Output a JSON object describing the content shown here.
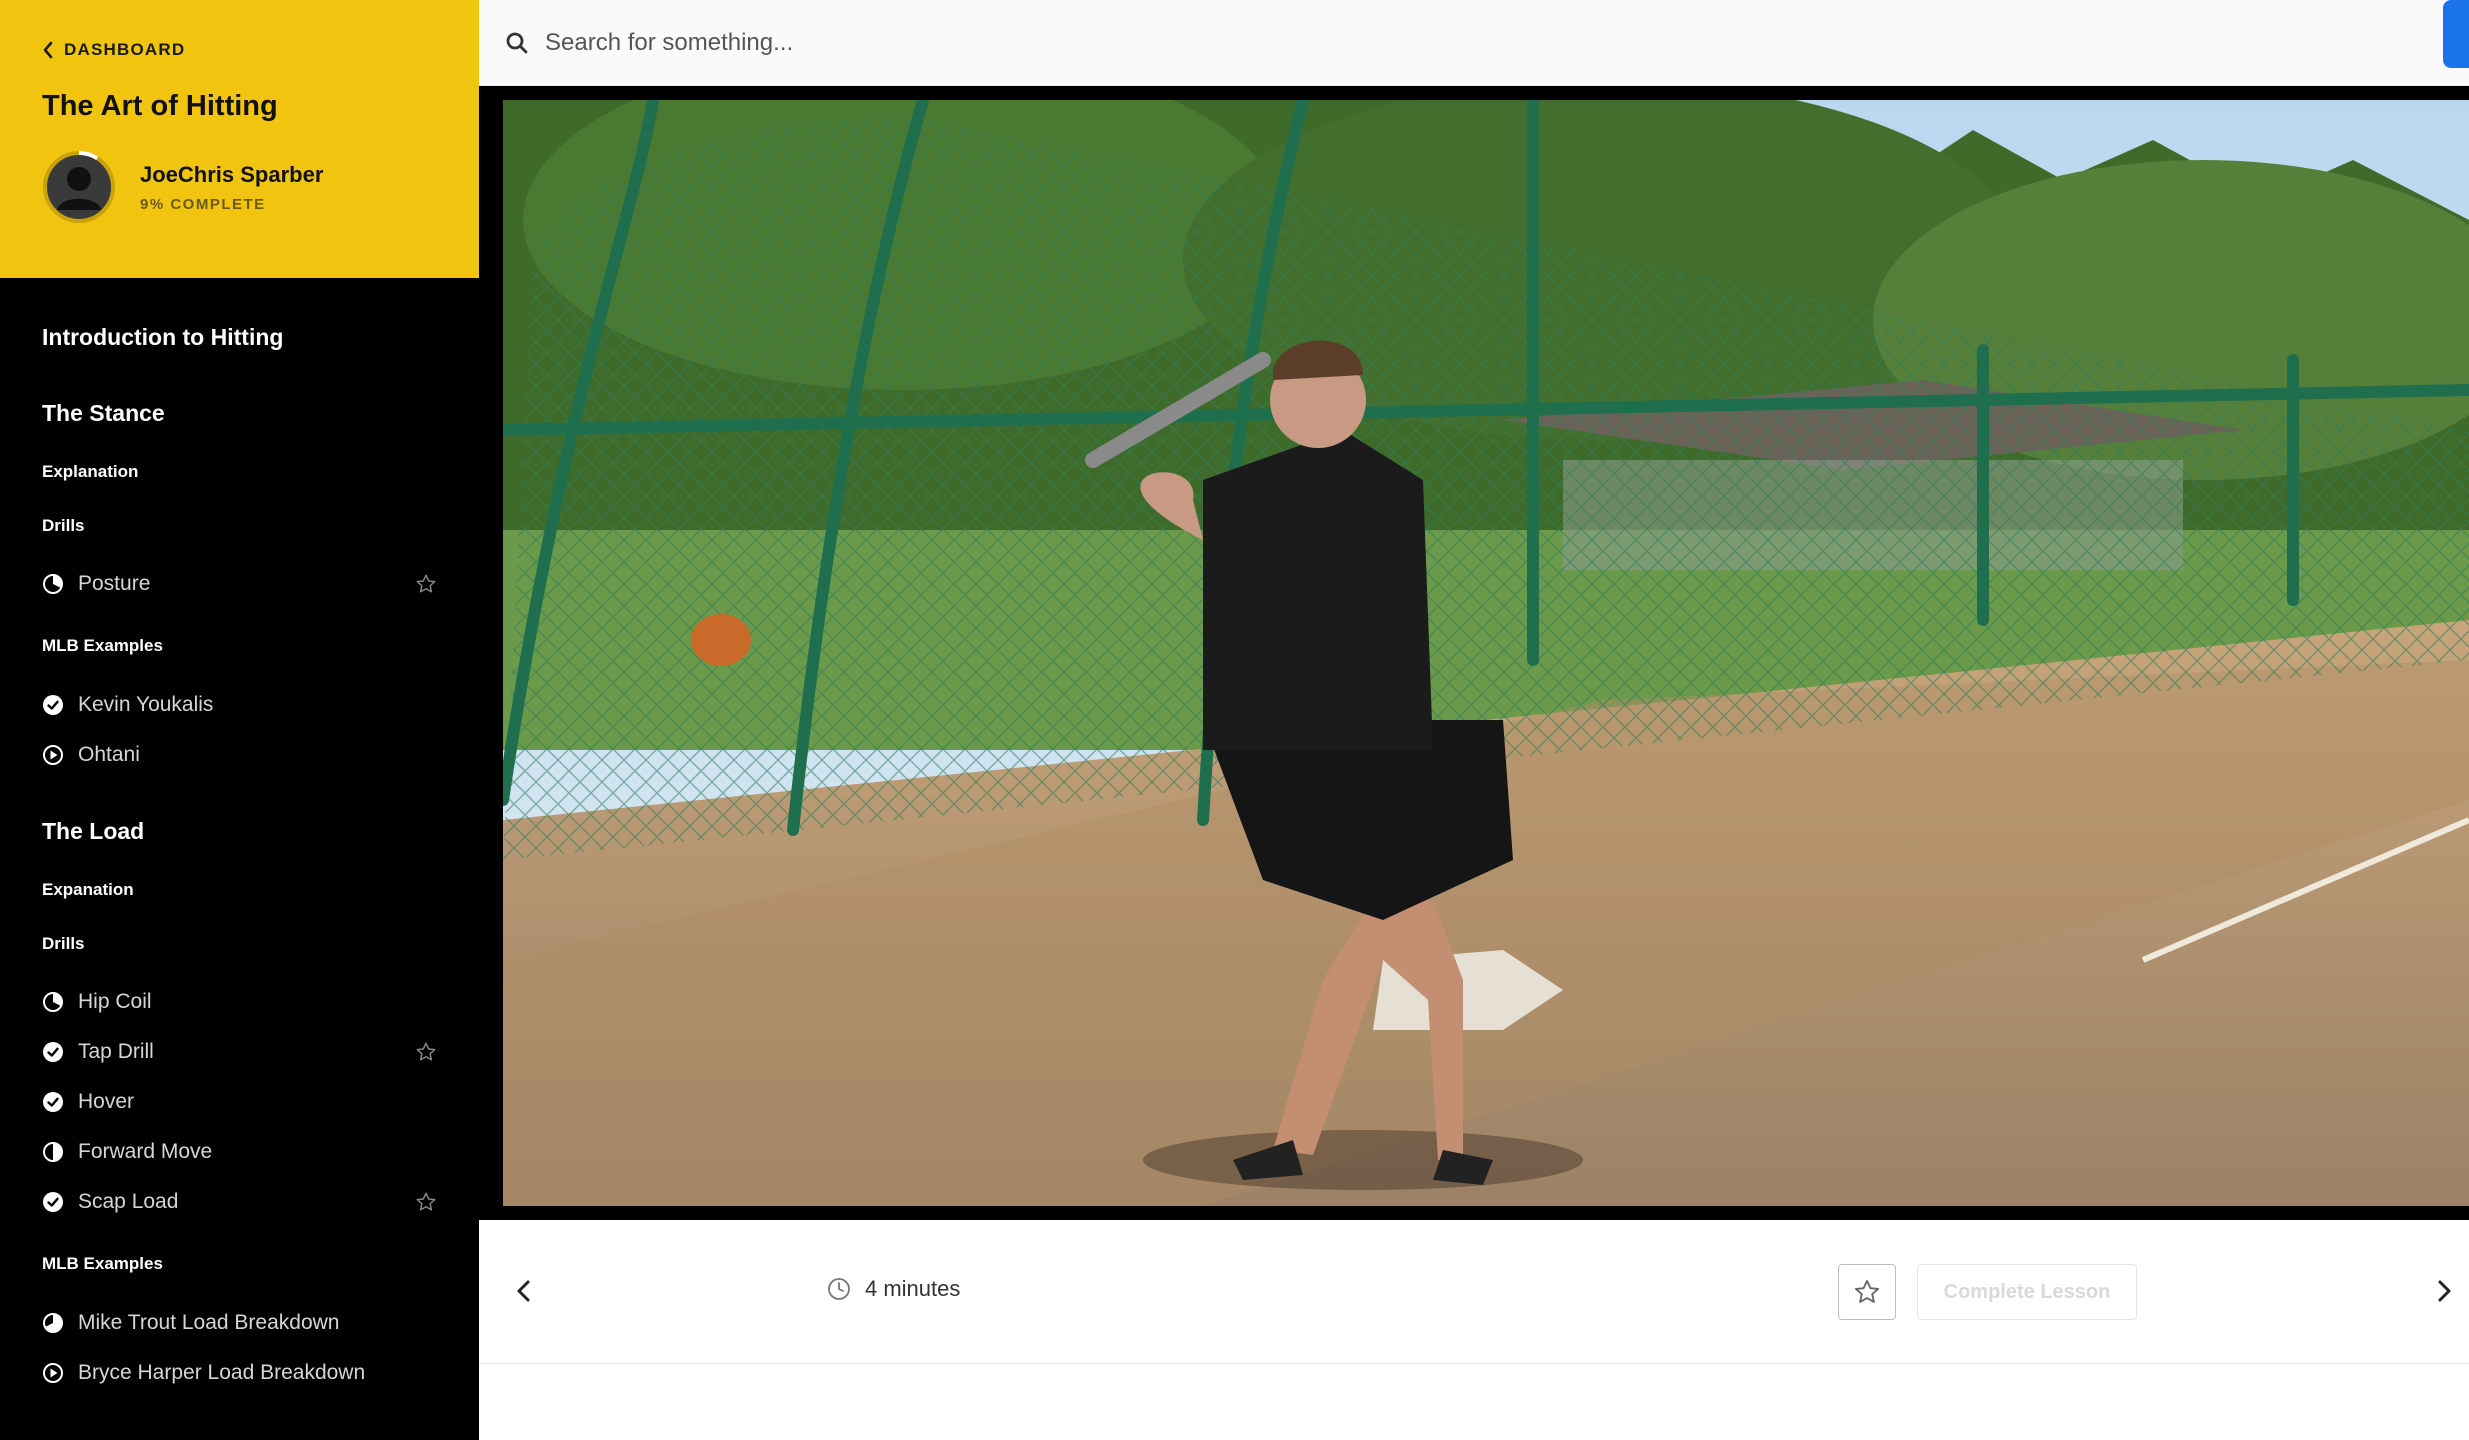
{
  "header": {
    "back_label": "DASHBOARD",
    "course_title": "The Art of Hitting",
    "user_name": "JoeChris Sparber",
    "progress_label": "9% COMPLETE",
    "progress_fraction": 0.09
  },
  "search": {
    "placeholder": "Search for something..."
  },
  "nav": {
    "intro": "Introduction to Hitting",
    "stance": {
      "title": "The Stance",
      "explanation": "Explanation",
      "drills_label": "Drills",
      "drills": [
        {
          "label": "Posture",
          "status": "partial",
          "starred": true
        }
      ],
      "mlb_label": "MLB Examples",
      "mlb": [
        {
          "label": "Kevin Youkalis",
          "status": "complete",
          "starred": false
        },
        {
          "label": "Ohtani",
          "status": "play",
          "starred": false
        }
      ]
    },
    "load": {
      "title": "The Load",
      "explanation": "Expanation",
      "drills_label": "Drills",
      "drills": [
        {
          "label": "Hip Coil",
          "status": "partial",
          "starred": false
        },
        {
          "label": "Tap Drill",
          "status": "complete",
          "starred": true
        },
        {
          "label": "Hover",
          "status": "complete",
          "starred": false
        },
        {
          "label": "Forward Move",
          "status": "half",
          "starred": false
        },
        {
          "label": "Scap Load",
          "status": "complete",
          "starred": true
        }
      ],
      "mlb_label": "MLB Examples",
      "mlb": [
        {
          "label": "Mike Trout Load Breakdown",
          "status": "mostly",
          "starred": false
        },
        {
          "label": "Bryce Harper Load Breakdown",
          "status": "play",
          "starred": false
        }
      ]
    }
  },
  "lesson": {
    "duration": "4 minutes",
    "complete_label": "Complete Lesson"
  },
  "colors": {
    "accent_yellow": "#f1c40f",
    "sidebar_bg": "#000000",
    "corner_tab": "#1a73e8"
  }
}
